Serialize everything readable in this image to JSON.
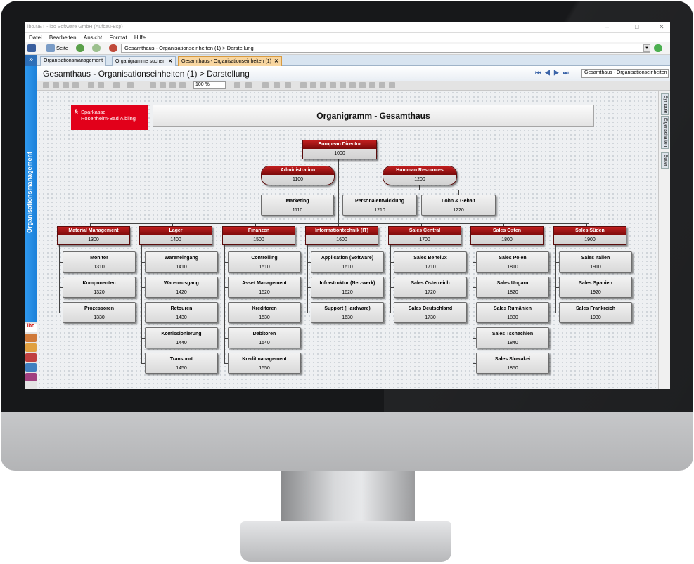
{
  "window": {
    "title": "ibo.NET - ibo Software GmbH (Aufbau-Bsp)"
  },
  "menu": [
    "Datei",
    "Bearbeiten",
    "Ansicht",
    "Format",
    "Hilfe"
  ],
  "toolbar": {
    "page_label": "Seite",
    "address": "Gesamthaus - Organisationseinheiten (1) > Darstellung"
  },
  "tabs": [
    {
      "label": "Organisationsmanagement",
      "closable": false,
      "active": false
    },
    {
      "label": "Organigramme suchen",
      "closable": true,
      "active": false
    },
    {
      "label": "Gesamthaus - Organisationseinheiten (1)",
      "closable": true,
      "active": true
    }
  ],
  "sidebar": {
    "label": "Organisationsmanagement",
    "brand": "ibo"
  },
  "doc": {
    "title": "Gesamthaus - Organisationseinheiten (1) > Darstellung",
    "view_select": "Gesamthaus - Organisationseinheiten (1) > Darstellung",
    "zoom": "100 %"
  },
  "right_tabs": [
    "Symbole",
    "Eigenschaften",
    "Butler"
  ],
  "logo": {
    "line1": "Sparkasse",
    "line2": "Rosenheim-Bad Aibling"
  },
  "chart_title": "Organigramm - Gesamthaus",
  "org": {
    "director": {
      "name": "European Director",
      "code": "1000"
    },
    "admin": {
      "name": "Administration",
      "code": "1100"
    },
    "marketing": {
      "name": "Marketing",
      "code": "1110"
    },
    "hr": {
      "name": "Humman Resources",
      "code": "1200"
    },
    "personal": {
      "name": "Personalentwicklung",
      "code": "1210"
    },
    "lohn": {
      "name": "Lohn & Gehalt",
      "code": "1220"
    },
    "depts": [
      {
        "name": "Material Management",
        "code": "1300",
        "children": [
          {
            "name": "Monitor",
            "code": "1310"
          },
          {
            "name": "Komponenten",
            "code": "1320"
          },
          {
            "name": "Prozessoren",
            "code": "1330"
          }
        ]
      },
      {
        "name": "Lager",
        "code": "1400",
        "children": [
          {
            "name": "Wareneingang",
            "code": "1410"
          },
          {
            "name": "Warenausgang",
            "code": "1420"
          },
          {
            "name": "Retouren",
            "code": "1430"
          },
          {
            "name": "Komissionierung",
            "code": "1440"
          },
          {
            "name": "Transport",
            "code": "1450"
          }
        ]
      },
      {
        "name": "Finanzen",
        "code": "1500",
        "children": [
          {
            "name": "Controlling",
            "code": "1510"
          },
          {
            "name": "Asset Management",
            "code": "1520"
          },
          {
            "name": "Kreditoren",
            "code": "1530"
          },
          {
            "name": "Debitoren",
            "code": "1540"
          },
          {
            "name": "Kreditmanagement",
            "code": "1550"
          }
        ]
      },
      {
        "name": "Informationtechnik (IT)",
        "code": "1600",
        "children": [
          {
            "name": "Application (Software)",
            "code": "1610"
          },
          {
            "name": "Infrastruktur (Netzwerk)",
            "code": "1620"
          },
          {
            "name": "Support (Hardware)",
            "code": "1630"
          }
        ]
      },
      {
        "name": "Sales Central",
        "code": "1700",
        "children": [
          {
            "name": "Sales Benelux",
            "code": "1710"
          },
          {
            "name": "Sales Österreich",
            "code": "1720"
          },
          {
            "name": "Sales Deutschland",
            "code": "1730"
          }
        ]
      },
      {
        "name": "Sales Osten",
        "code": "1800",
        "children": [
          {
            "name": "Sales Polen",
            "code": "1810"
          },
          {
            "name": "Sales Ungarn",
            "code": "1820"
          },
          {
            "name": "Sales Rumänien",
            "code": "1830"
          },
          {
            "name": "Sales Tschechien",
            "code": "1840"
          },
          {
            "name": "Sales Slowakei",
            "code": "1850"
          }
        ]
      },
      {
        "name": "Sales Süden",
        "code": "1900",
        "children": [
          {
            "name": "Sales Italien",
            "code": "1910"
          },
          {
            "name": "Sales Spanien",
            "code": "1920"
          },
          {
            "name": "Sales Frankreich",
            "code": "1930"
          }
        ]
      }
    ]
  }
}
